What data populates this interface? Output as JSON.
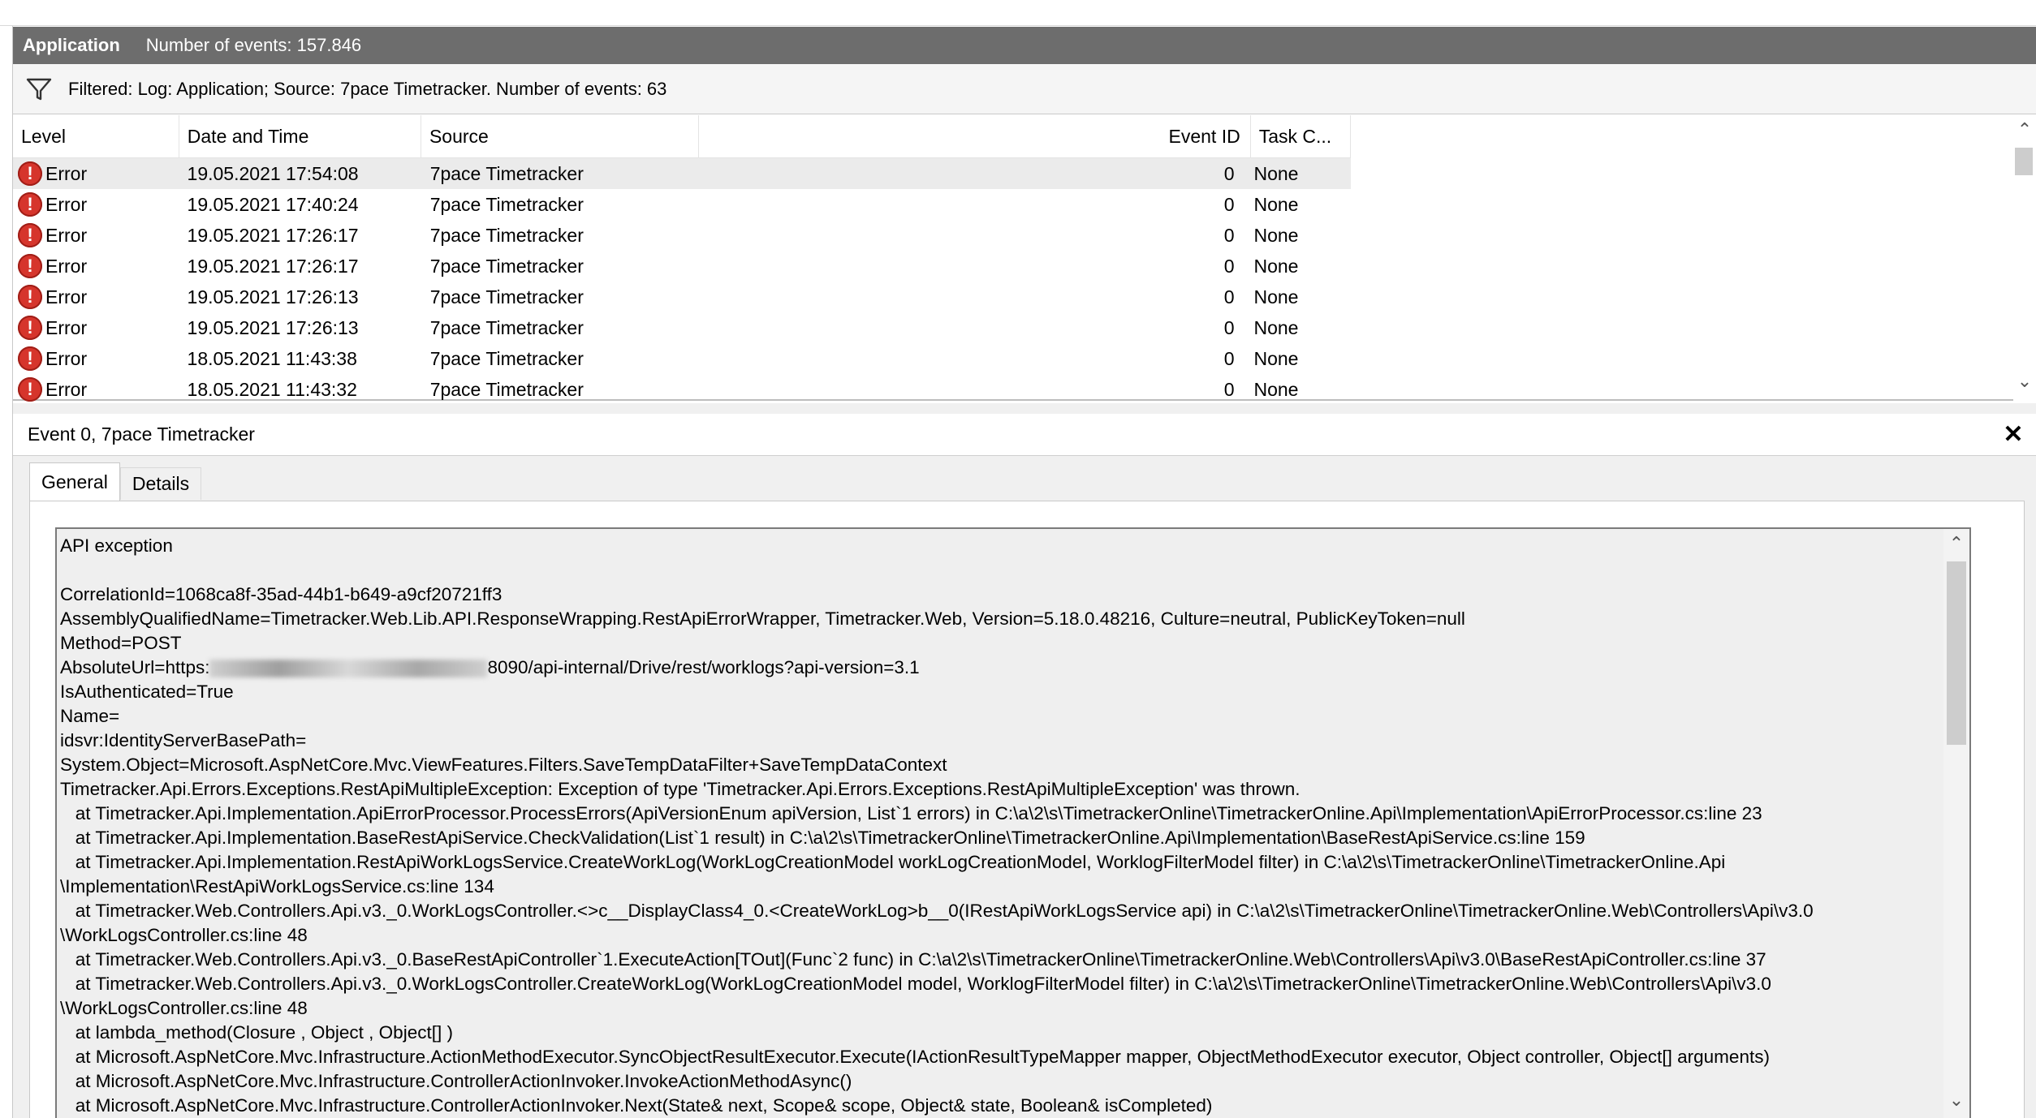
{
  "titlebar": {
    "app": "Application",
    "count": "Number of events: 157.846"
  },
  "filter": {
    "text": "Filtered: Log: Application; Source: 7pace Timetracker. Number of events: 63"
  },
  "columns": {
    "level": "Level",
    "date": "Date and Time",
    "source": "Source",
    "event_id": "Event ID",
    "task": "Task C..."
  },
  "rows": [
    {
      "level": "Error",
      "date": "19.05.2021 17:54:08",
      "source": "7pace Timetracker",
      "event_id": "0",
      "task": "None"
    },
    {
      "level": "Error",
      "date": "19.05.2021 17:40:24",
      "source": "7pace Timetracker",
      "event_id": "0",
      "task": "None"
    },
    {
      "level": "Error",
      "date": "19.05.2021 17:26:17",
      "source": "7pace Timetracker",
      "event_id": "0",
      "task": "None"
    },
    {
      "level": "Error",
      "date": "19.05.2021 17:26:17",
      "source": "7pace Timetracker",
      "event_id": "0",
      "task": "None"
    },
    {
      "level": "Error",
      "date": "19.05.2021 17:26:13",
      "source": "7pace Timetracker",
      "event_id": "0",
      "task": "None"
    },
    {
      "level": "Error",
      "date": "19.05.2021 17:26:13",
      "source": "7pace Timetracker",
      "event_id": "0",
      "task": "None"
    },
    {
      "level": "Error",
      "date": "18.05.2021 11:43:38",
      "source": "7pace Timetracker",
      "event_id": "0",
      "task": "None"
    },
    {
      "level": "Error",
      "date": "18.05.2021 11:43:32",
      "source": "7pace Timetracker",
      "event_id": "0",
      "task": "None"
    }
  ],
  "details": {
    "header": "Event 0, 7pace Timetracker",
    "tabs": [
      "General",
      "Details"
    ],
    "line1": "API exception",
    "line2": "",
    "line3": "CorrelationId=1068ca8f-35ad-44b1-b649-a9cf20721ff3",
    "line4": "AssemblyQualifiedName=Timetracker.Web.Lib.API.ResponseWrapping.RestApiErrorWrapper, Timetracker.Web, Version=5.18.0.48216, Culture=neutral, PublicKeyToken=null",
    "line5": "Method=POST",
    "line6a": "AbsoluteUrl=https:",
    "line6b": "8090/api-internal/Drive/rest/worklogs?api-version=3.1",
    "line7": "IsAuthenticated=True",
    "line8": "Name=",
    "line9": "idsvr:IdentityServerBasePath=",
    "line10": "System.Object=Microsoft.AspNetCore.Mvc.ViewFeatures.Filters.SaveTempDataFilter+SaveTempDataContext",
    "line11": "Timetracker.Api.Errors.Exceptions.RestApiMultipleException: Exception of type 'Timetracker.Api.Errors.Exceptions.RestApiMultipleException' was thrown.",
    "line12": "   at Timetracker.Api.Implementation.ApiErrorProcessor.ProcessErrors(ApiVersionEnum apiVersion, List`1 errors) in C:\\a\\2\\s\\TimetrackerOnline\\TimetrackerOnline.Api\\Implementation\\ApiErrorProcessor.cs:line 23",
    "line13": "   at Timetracker.Api.Implementation.BaseRestApiService.CheckValidation(List`1 result) in C:\\a\\2\\s\\TimetrackerOnline\\TimetrackerOnline.Api\\Implementation\\BaseRestApiService.cs:line 159",
    "line14": "   at Timetracker.Api.Implementation.RestApiWorkLogsService.CreateWorkLog(WorkLogCreationModel workLogCreationModel, WorklogFilterModel filter) in C:\\a\\2\\s\\TimetrackerOnline\\TimetrackerOnline.Api",
    "line15": "\\Implementation\\RestApiWorkLogsService.cs:line 134",
    "line16": "   at Timetracker.Web.Controllers.Api.v3._0.WorkLogsController.<>c__DisplayClass4_0.<CreateWorkLog>b__0(IRestApiWorkLogsService api) in C:\\a\\2\\s\\TimetrackerOnline\\TimetrackerOnline.Web\\Controllers\\Api\\v3.0",
    "line17": "\\WorkLogsController.cs:line 48",
    "line18": "   at Timetracker.Web.Controllers.Api.v3._0.BaseRestApiController`1.ExecuteAction[TOut](Func`2 func) in C:\\a\\2\\s\\TimetrackerOnline\\TimetrackerOnline.Web\\Controllers\\Api\\v3.0\\BaseRestApiController.cs:line 37",
    "line19": "   at Timetracker.Web.Controllers.Api.v3._0.WorkLogsController.CreateWorkLog(WorkLogCreationModel model, WorklogFilterModel filter) in C:\\a\\2\\s\\TimetrackerOnline\\TimetrackerOnline.Web\\Controllers\\Api\\v3.0",
    "line20": "\\WorkLogsController.cs:line 48",
    "line21": "   at lambda_method(Closure , Object , Object[] )",
    "line22": "   at Microsoft.AspNetCore.Mvc.Infrastructure.ActionMethodExecutor.SyncObjectResultExecutor.Execute(IActionResultTypeMapper mapper, ObjectMethodExecutor executor, Object controller, Object[] arguments)",
    "line23": "   at Microsoft.AspNetCore.Mvc.Infrastructure.ControllerActionInvoker.InvokeActionMethodAsync()",
    "line24": "   at Microsoft.AspNetCore.Mvc.Infrastructure.ControllerActionInvoker.Next(State& next, Scope& scope, Object& state, Boolean& isCompleted)"
  },
  "icons": {
    "filter": "funnel-icon",
    "level": "error-icon",
    "close": "close-icon",
    "scroll_up": "chevron-up-icon",
    "scroll_down": "chevron-down-icon"
  },
  "colors": {
    "titlebar": "#6d6d6d",
    "error": "#d6352c",
    "selected_row": "#ebebeb"
  }
}
